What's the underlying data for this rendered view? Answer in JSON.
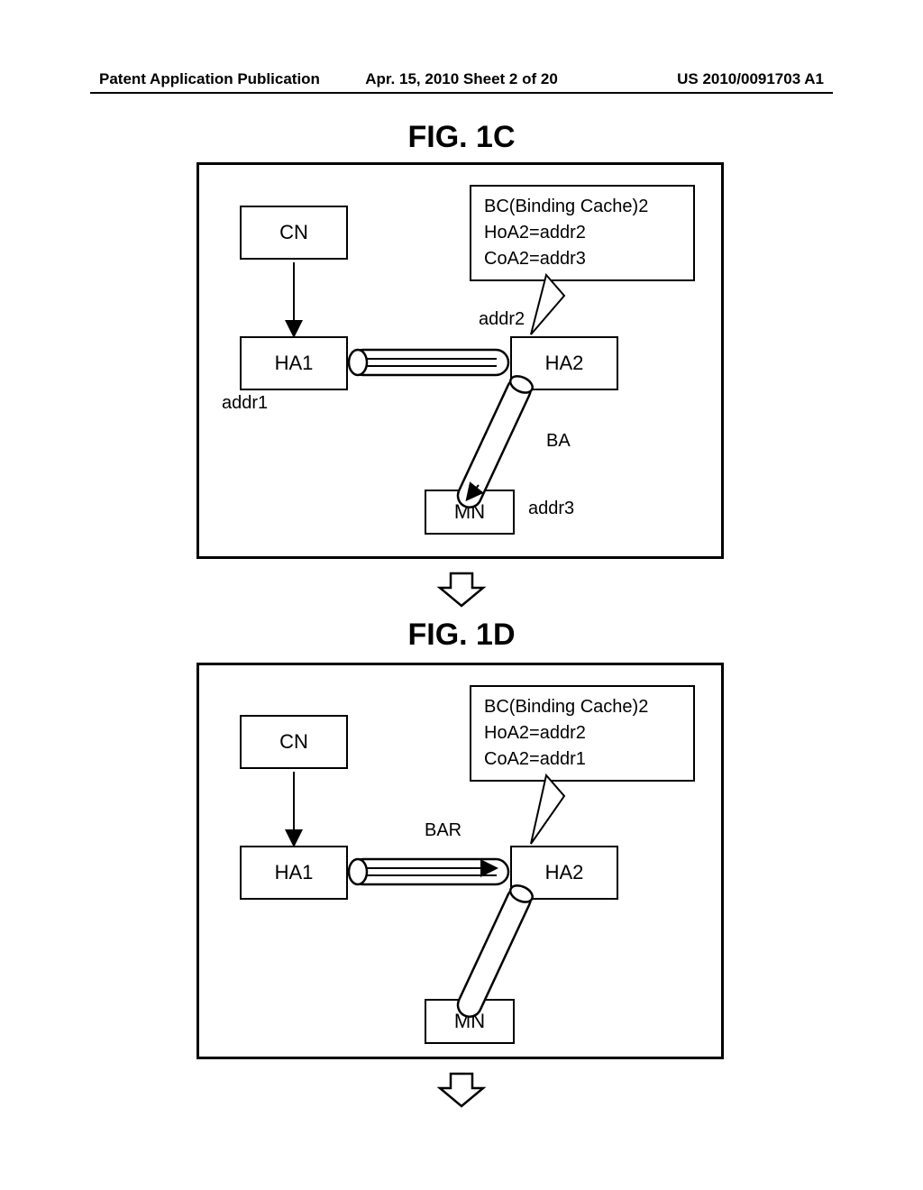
{
  "header": {
    "left": "Patent Application Publication",
    "middle": "Apr. 15, 2010  Sheet 2 of 20",
    "right": "US 2010/0091703 A1"
  },
  "fig1c": {
    "title": "FIG. 1C",
    "cn": "CN",
    "ha1": "HA1",
    "ha2": "HA2",
    "mn": "MN",
    "addr1": "addr1",
    "addr2": "addr2",
    "addr3": "addr3",
    "ba": "BA",
    "callout": {
      "l1": "BC(Binding Cache)2",
      "l2": "HoA2=addr2",
      "l3": "CoA2=addr3"
    }
  },
  "fig1d": {
    "title": "FIG. 1D",
    "cn": "CN",
    "ha1": "HA1",
    "ha2": "HA2",
    "mn": "MN",
    "bar": "BAR",
    "callout": {
      "l1": "BC(Binding Cache)2",
      "l2": "HoA2=addr2",
      "l3": "CoA2=addr1"
    }
  }
}
